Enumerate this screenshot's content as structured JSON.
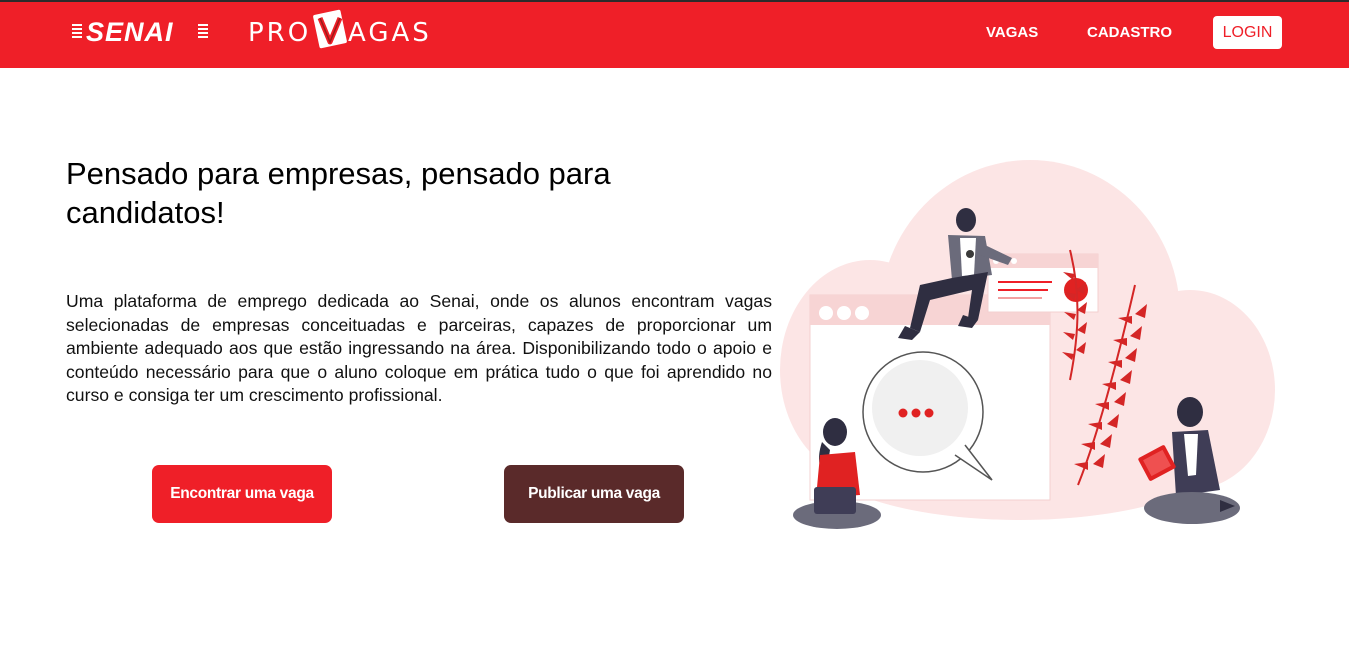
{
  "navbar": {
    "senai_logo_text": "SENAI",
    "provagas_pro": "PRO",
    "provagas_v": "V",
    "provagas_agas": "AGAS",
    "links": {
      "vagas": "VAGAS",
      "cadastro": "CADASTRO"
    },
    "login_label": "LOGIN"
  },
  "hero": {
    "headline": "Pensado para empresas, pensado para candidatos!",
    "description": "Uma plataforma de emprego dedicada ao Senai, onde os alunos encontram vagas selecionadas de empresas conceituadas e parceiras, capazes de proporcionar um ambiente adequado aos que estão ingressando na área. Disponibilizando todo o apoio e conteúdo necessário para que o aluno coloque em prática tudo o que foi aprendido no curso e consiga ter um crescimento profissional.",
    "find_button": "Encontrar uma vaga",
    "publish_button": "Publicar uma vaga"
  },
  "colors": {
    "brand_red": "#ef1f28",
    "publish_brown": "#5a2a2a",
    "illustration_pink": "#fbe3e3"
  },
  "icons": {
    "senai_logo": "senai-logo",
    "provagas_logo": "provagas-logo",
    "illustration": "people-networking-illustration"
  }
}
